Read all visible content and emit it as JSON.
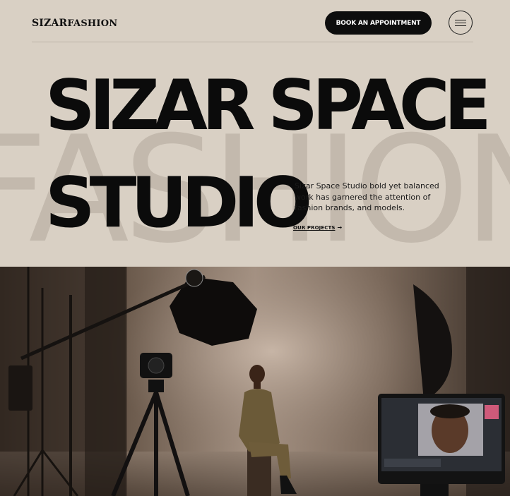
{
  "header": {
    "logo_prefix": "SIZAR",
    "logo_suffix": "FASHION",
    "book_label": "BOOK AN APPOINTMENT",
    "menu_icon": "hamburger-icon"
  },
  "hero": {
    "background_word": "FASHION",
    "title_line1": "SIZAR SPACE",
    "title_line2": "STUDIO",
    "description": "Sizar Space Studio bold yet balanced work has garnered the attention of fashion brands, and models.",
    "projects_link": "OUR PROJECTS",
    "arrow_icon": "arrow-right-icon"
  },
  "colors": {
    "background": "#d9d0c4",
    "accent_dark": "#0d0d0d",
    "background_word": "#c3b9ad"
  }
}
